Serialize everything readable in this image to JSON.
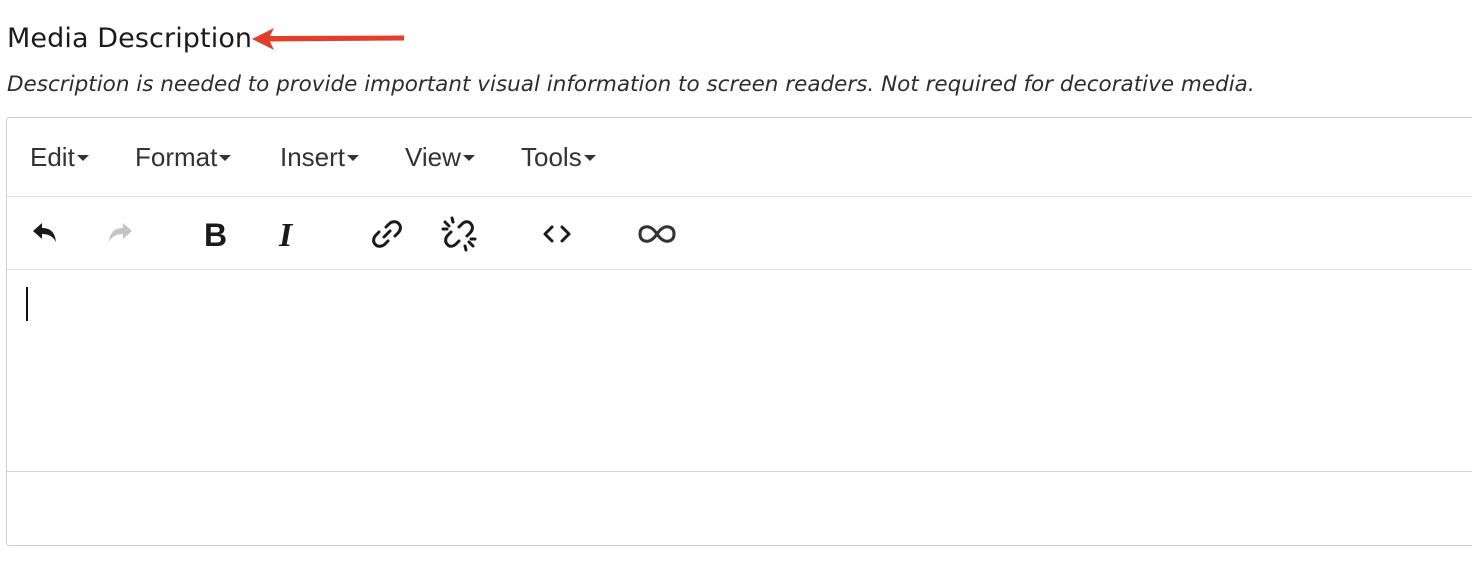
{
  "field": {
    "label": "Media Description",
    "help_text": "Description is needed to provide important visual information to screen readers. Not required for decorative media."
  },
  "annotation": {
    "arrow_color": "#e0402b"
  },
  "editor": {
    "menus": [
      {
        "label": "Edit"
      },
      {
        "label": "Format"
      },
      {
        "label": "Insert"
      },
      {
        "label": "View"
      },
      {
        "label": "Tools"
      }
    ],
    "toolbar": [
      {
        "icon": "undo-icon",
        "enabled": true
      },
      {
        "icon": "redo-icon",
        "enabled": false
      },
      {
        "icon": "bold-icon",
        "enabled": true
      },
      {
        "icon": "italic-icon",
        "enabled": true
      },
      {
        "icon": "link-icon",
        "enabled": true
      },
      {
        "icon": "unlink-icon",
        "enabled": true
      },
      {
        "icon": "source-code-icon",
        "enabled": true
      },
      {
        "icon": "infinity-icon",
        "enabled": true
      }
    ],
    "content": ""
  }
}
